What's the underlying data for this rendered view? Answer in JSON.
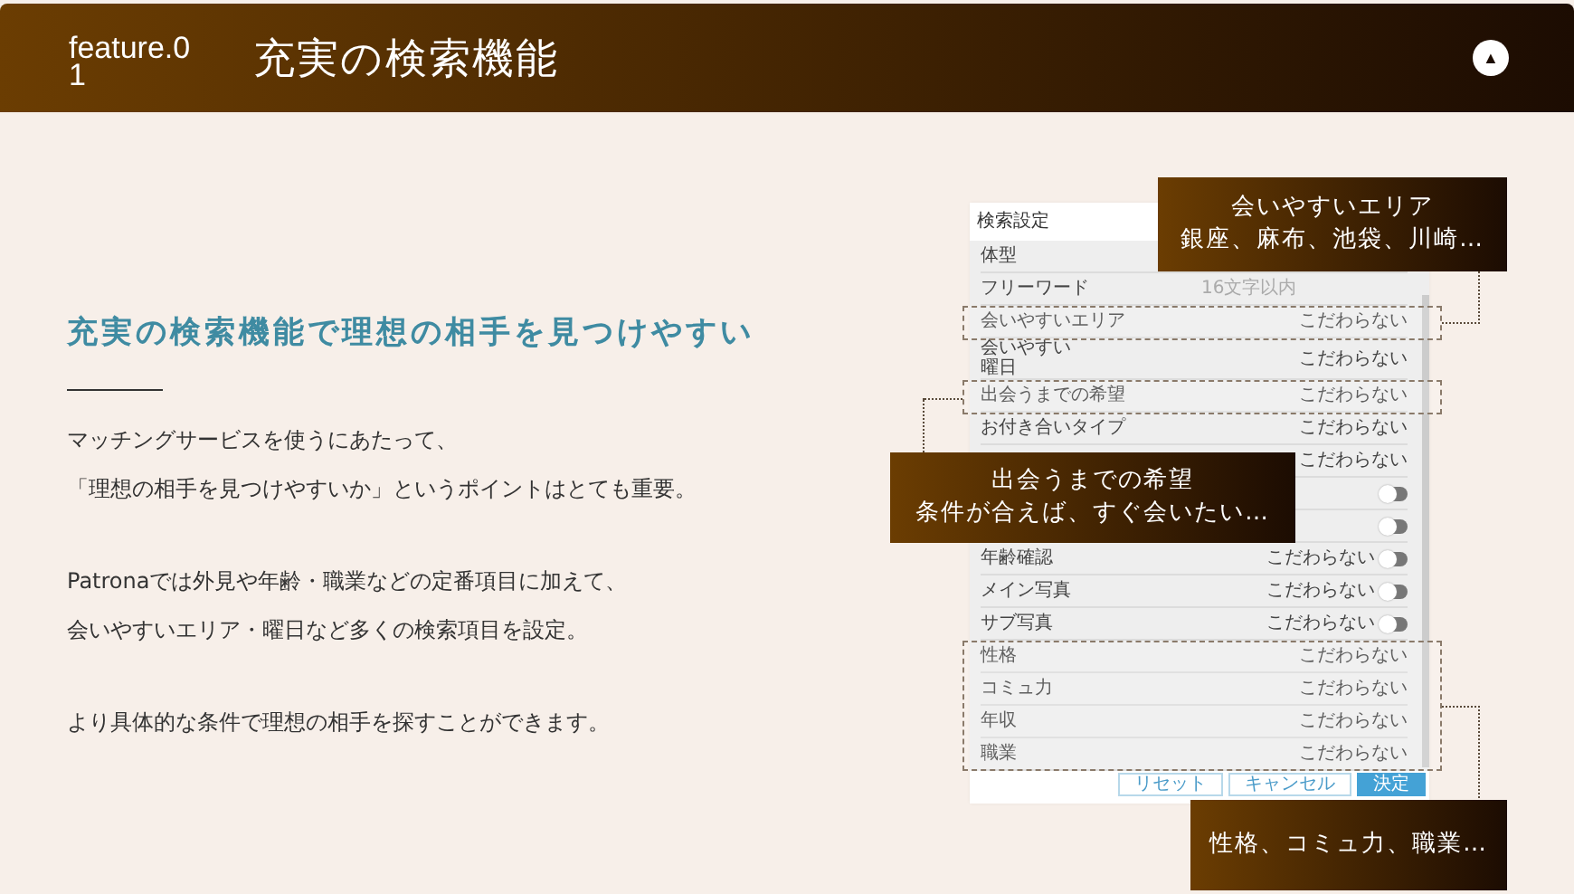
{
  "header": {
    "feature": "feature.01",
    "title": "充実の検索機能",
    "toggle_icon": "▲"
  },
  "intro": {
    "heading": "充実の検索機能で理想の相手を見つけやすい",
    "paragraphs": [
      [
        "マッチングサービスを使うにあたって、",
        "「理想の相手を見つけやすいか」というポイントはとても重要。"
      ],
      [
        "Patronaでは外見や年齢・職業などの定番項目に加えて、",
        "会いやすいエリア・曜日など多くの検索項目を設定。"
      ],
      [
        "より具体的な条件で理想の相手を探すことができます。"
      ]
    ]
  },
  "panel": {
    "title": "検索設定",
    "rows": [
      {
        "kind": "text",
        "label": "体型"
      },
      {
        "kind": "field",
        "label": "フリーワード",
        "placeholder": "16文字以内"
      },
      {
        "kind": "text",
        "label": "会いやすいエリア",
        "value": "こだわらない"
      },
      {
        "kind": "text",
        "label": [
          "会いやすい",
          "曜日"
        ],
        "value": "こだわらない"
      },
      {
        "kind": "text",
        "label": "出会うまでの希望",
        "value": "こだわらない"
      },
      {
        "kind": "text",
        "label": "お付き合いタイプ",
        "value": "こだわらない"
      },
      {
        "kind": "text",
        "value": "こだわらない"
      },
      {
        "kind": "toggle",
        "on": false
      },
      {
        "kind": "toggle",
        "on": false
      },
      {
        "kind": "toggle",
        "label": "年齢確認",
        "value": "こだわらない",
        "on": false
      },
      {
        "kind": "toggle",
        "label": "メイン写真",
        "value": "こだわらない",
        "on": false
      },
      {
        "kind": "toggle",
        "label": "サブ写真",
        "value": "こだわらない",
        "on": false
      },
      {
        "kind": "text",
        "label": "性格",
        "value": "こだわらない"
      },
      {
        "kind": "text",
        "label": "コミュ力",
        "value": "こだわらない"
      },
      {
        "kind": "text",
        "label": "年収",
        "value": "こだわらない"
      },
      {
        "kind": "text",
        "label": "職業",
        "value": "こだわらない"
      }
    ],
    "buttons": [
      {
        "label": "リセット",
        "kind": "outline"
      },
      {
        "label": "キャンセル",
        "kind": "outline"
      },
      {
        "label": "決定",
        "kind": "primary"
      }
    ]
  },
  "callouts": [
    {
      "title": "会いやすいエリア",
      "text": "銀座、麻布、池袋、川崎…"
    },
    {
      "title": "出会うまでの希望",
      "text": "条件が合えば、すぐ会いたい…"
    },
    {
      "text": "性格、コミュ力、職業…"
    }
  ]
}
